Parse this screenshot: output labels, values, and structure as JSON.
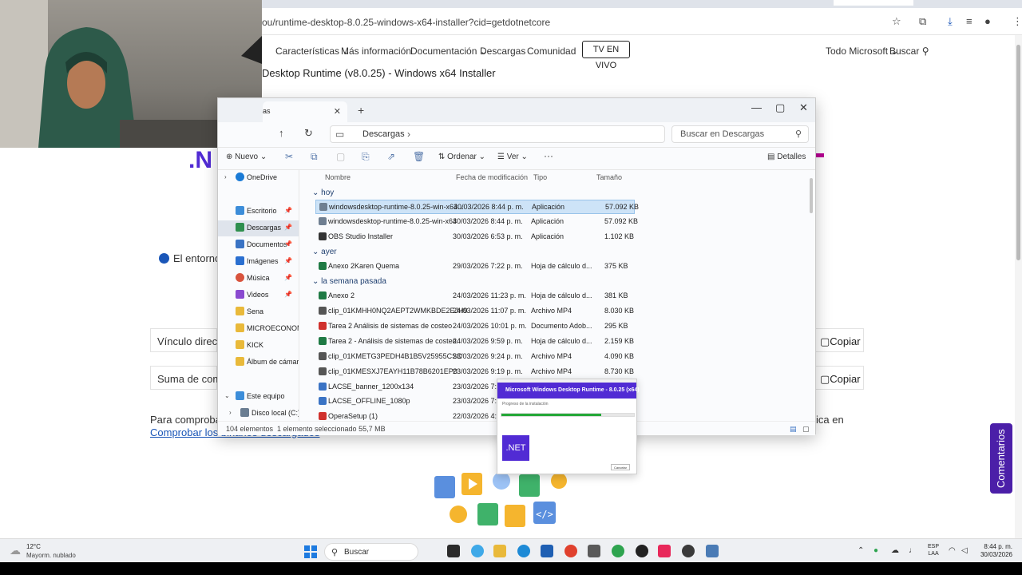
{
  "browser": {
    "url": "ou/runtime-desktop-8.0.25-windows-x64-installer?cid=getdotnetcore",
    "nav": [
      "Características",
      "Más información",
      "Documentación",
      "Descargas",
      "Comunidad"
    ],
    "tv_button": "TV EN VIVO",
    "microsoft_menu": "Todo Microsoft",
    "search_label": "Buscar"
  },
  "page": {
    "title": "Desktop Runtime (v8.0.25) - Windows x64 Installer",
    "env_text": "El entorno",
    "direct_link_label": "Vínculo directo",
    "checksum_label": "Suma de comp",
    "copy_label": "Copiar",
    "verify_text": "Para comprobar",
    "verify_suffix": "ica en",
    "verify_link": "Comprobar los binarios descargados",
    "feedback_button": "Comentarios"
  },
  "explorer": {
    "tab_title": "as",
    "path": "Descargas",
    "search_placeholder": "Buscar en Descargas",
    "commands": {
      "new": "Nuevo",
      "sort": "Ordenar",
      "view": "Ver",
      "more": "···",
      "details": "Detalles"
    },
    "columns": [
      "Nombre",
      "Fecha de modificación",
      "Tipo",
      "Tamaño"
    ],
    "nav": [
      {
        "label": "OneDrive",
        "color": "#1b7bd6"
      },
      {
        "label": "Escritorio",
        "color": "#3c8dd9"
      },
      {
        "label": "Descargas",
        "color": "#2f8f4e"
      },
      {
        "label": "Documentos",
        "color": "#3a73c4"
      },
      {
        "label": "Imágenes",
        "color": "#2a6fd0"
      },
      {
        "label": "Música",
        "color": "#d8533d"
      },
      {
        "label": "Videos",
        "color": "#8a4ad0"
      },
      {
        "label": "Sena",
        "color": "#e9b93a"
      },
      {
        "label": "MICROECONOMÍ",
        "color": "#e9b93a"
      },
      {
        "label": "KICK",
        "color": "#e9b93a"
      },
      {
        "label": "Álbum de cámara",
        "color": "#e9b93a"
      },
      {
        "label": "Este equipo",
        "color": "#3c8dd9"
      },
      {
        "label": "Disco local (C:)",
        "color": "#6a7d92"
      }
    ],
    "groups": [
      "hoy",
      "ayer",
      "la semana pasada"
    ],
    "files": [
      {
        "name": "windowsdesktop-runtime-8.0.25-win-x64...",
        "date": "30/03/2026 8:44 p. m.",
        "type": "Aplicación",
        "size": "57.092 KB",
        "color": "#6f7f91"
      },
      {
        "name": "windowsdesktop-runtime-8.0.25-win-x64",
        "date": "30/03/2026 8:44 p. m.",
        "type": "Aplicación",
        "size": "57.092 KB",
        "color": "#6f7f91"
      },
      {
        "name": "OBS Studio Installer",
        "date": "30/03/2026 6:53 p. m.",
        "type": "Aplicación",
        "size": "1.102 KB",
        "color": "#333333"
      },
      {
        "name": "Anexo 2Karen Quema",
        "date": "29/03/2026 7:22 p. m.",
        "type": "Hoja de cálculo d...",
        "size": "375 KB",
        "color": "#1f7a44"
      },
      {
        "name": "Anexo 2",
        "date": "24/03/2026 11:23 p. m.",
        "type": "Hoja de cálculo d...",
        "size": "381 KB",
        "color": "#1f7a44"
      },
      {
        "name": "clip_01KMHH0NQ2AEPT2WMKBDE2EJH9",
        "date": "24/03/2026 11:07 p. m.",
        "type": "Archivo MP4",
        "size": "8.030 KB",
        "color": "#555555"
      },
      {
        "name": "Tarea 2 Análisis de sistemas de costeo",
        "date": "24/03/2026 10:01 p. m.",
        "type": "Documento Adob...",
        "size": "295 KB",
        "color": "#d0312d"
      },
      {
        "name": "Tarea 2 - Análisis de sistemas de costeo.",
        "date": "24/03/2026 9:59 p. m.",
        "type": "Hoja de cálculo d...",
        "size": "2.159 KB",
        "color": "#1f7a44"
      },
      {
        "name": "clip_01KMETG3PEDH4B1B5V25955CSC",
        "date": "23/03/2026 9:24 p. m.",
        "type": "Archivo MP4",
        "size": "4.090 KB",
        "color": "#555555"
      },
      {
        "name": "clip_01KMESXJ7EAYH11B78B6201EP0",
        "date": "23/03/2026 9:19 p. m.",
        "type": "Archivo MP4",
        "size": "8.730 KB",
        "color": "#555555"
      },
      {
        "name": "LACSE_banner_1200x134",
        "date": "23/03/2026 7:0",
        "type": "",
        "size": "",
        "color": "#3a73c4"
      },
      {
        "name": "LACSE_OFFLINE_1080p",
        "date": "23/03/2026 7:0",
        "type": "",
        "size": "",
        "color": "#3a73c4"
      },
      {
        "name": "OperaSetup (1)",
        "date": "22/03/2026 4:5",
        "type": "",
        "size": "",
        "color": "#d0312d"
      }
    ],
    "status_count": "104 elementos",
    "status_selected": "1 elemento seleccionado  55,7 MB"
  },
  "installer": {
    "title": "Microsoft Windows Desktop Runtime - 8.0.25 (x64)",
    "subtitle": "Progreso de la instalación",
    "progress": 0.75,
    "logo": ".NET",
    "cancel": "Cancelar"
  },
  "taskbar": {
    "temp": "12°C",
    "weather": "Mayorm. nublado",
    "search": "Buscar",
    "lang1": "ESP",
    "lang2": "LAA",
    "time": "8:44 p. m.",
    "date": "30/03/2026"
  }
}
